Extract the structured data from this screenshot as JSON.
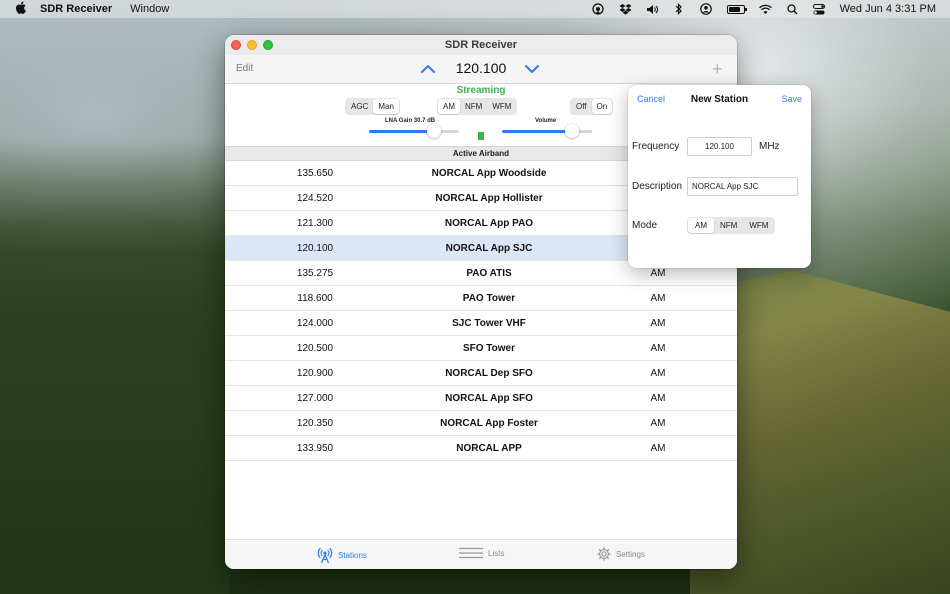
{
  "menubar": {
    "app_name": "SDR Receiver",
    "menus": [
      "Window"
    ],
    "clock": "Wed Jun 4  3:31 PM",
    "icons": [
      "apple-icon",
      "airplay-icon",
      "dropbox-icon",
      "volume-icon",
      "bluetooth-icon",
      "user-icon",
      "battery-icon",
      "wifi-icon",
      "search-icon",
      "control-center-icon"
    ]
  },
  "window": {
    "title": "SDR Receiver"
  },
  "toolbar": {
    "edit_label": "Edit",
    "frequency": "120.100",
    "add_label": "+"
  },
  "controls": {
    "status": "Streaming",
    "status_color": "#3bb24a",
    "gain_modes": [
      "AGC",
      "Man"
    ],
    "gain_mode_selected": "Man",
    "modulation": [
      "AM",
      "NFM",
      "WFM"
    ],
    "modulation_selected": "AM",
    "power": [
      "Off",
      "On"
    ],
    "power_selected": "On",
    "lna_gain_label": "LNA Gain  30.7 dB",
    "lna_gain_fraction": 0.72,
    "volume_label": "Volume",
    "volume_fraction": 0.78
  },
  "list": {
    "section_title": "Active Airband",
    "selected_index": 3,
    "stations": [
      {
        "freq": "135.650",
        "name": "NORCAL App Woodside",
        "mode": ""
      },
      {
        "freq": "124.520",
        "name": "NORCAL App Hollister",
        "mode": ""
      },
      {
        "freq": "121.300",
        "name": "NORCAL App PAO",
        "mode": ""
      },
      {
        "freq": "120.100",
        "name": "NORCAL App SJC",
        "mode": ""
      },
      {
        "freq": "135.275",
        "name": "PAO ATIS",
        "mode": "AM"
      },
      {
        "freq": "118.600",
        "name": "PAO Tower",
        "mode": "AM"
      },
      {
        "freq": "124.000",
        "name": "SJC Tower VHF",
        "mode": "AM"
      },
      {
        "freq": "120.500",
        "name": "SFO Tower",
        "mode": "AM"
      },
      {
        "freq": "120.900",
        "name": "NORCAL Dep SFO",
        "mode": "AM"
      },
      {
        "freq": "127.000",
        "name": "NORCAL App SFO",
        "mode": "AM"
      },
      {
        "freq": "120.350",
        "name": "NORCAL App Foster",
        "mode": "AM"
      },
      {
        "freq": "133.950",
        "name": "NORCAL APP",
        "mode": "AM"
      }
    ]
  },
  "tabs": {
    "stations": "Stations",
    "lists": "Lists",
    "settings": "Settings",
    "active": "stations",
    "accent": "#2f7df6"
  },
  "popover": {
    "cancel": "Cancel",
    "title": "New Station",
    "save": "Save",
    "frequency_label": "Frequency",
    "frequency_value": "120.100",
    "frequency_unit": "MHz",
    "description_label": "Description",
    "description_value": "NORCAL App SJC",
    "mode_label": "Mode",
    "modes": [
      "AM",
      "NFM",
      "WFM"
    ],
    "mode_selected": "AM"
  }
}
